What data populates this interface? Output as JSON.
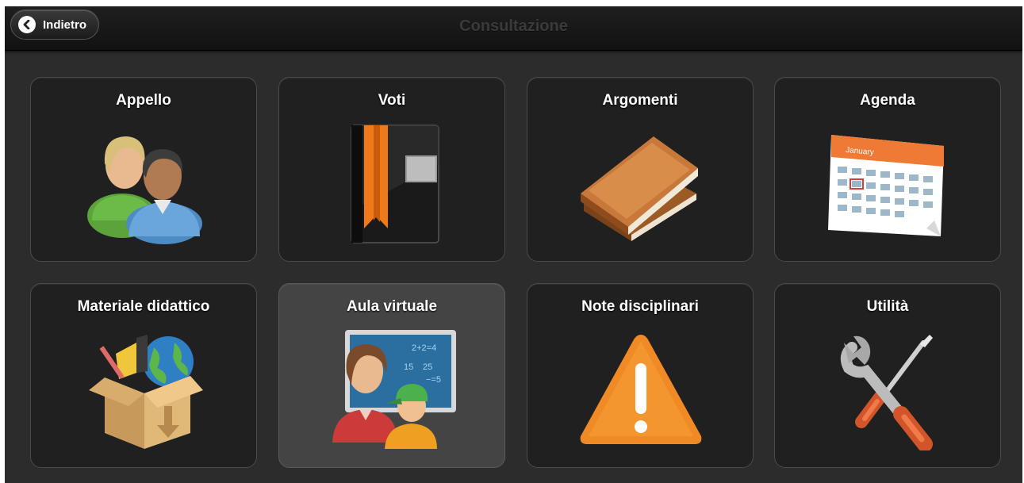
{
  "header": {
    "back_label": "Indietro",
    "title": "Consultazione"
  },
  "tiles": [
    {
      "label": "Appello",
      "icon": "people-icon"
    },
    {
      "label": "Voti",
      "icon": "grade-book-icon"
    },
    {
      "label": "Argomenti",
      "icon": "books-icon"
    },
    {
      "label": "Agenda",
      "icon": "calendar-icon",
      "calendar_month": "January"
    },
    {
      "label": "Materiale didattico",
      "icon": "materials-box-icon"
    },
    {
      "label": "Aula virtuale",
      "icon": "virtual-classroom-icon",
      "board_text": [
        "2+2=4",
        "25",
        "−=5",
        "15"
      ]
    },
    {
      "label": "Note disciplinari",
      "icon": "warning-icon"
    },
    {
      "label": "Utilità",
      "icon": "tools-icon"
    }
  ],
  "colors": {
    "background": "#2c2c2c",
    "header": "#151515",
    "tile": "#202020",
    "tile_active": "#444444",
    "accent_orange": "#f07a1a"
  },
  "state": {
    "active_tile": "Aula virtuale"
  }
}
